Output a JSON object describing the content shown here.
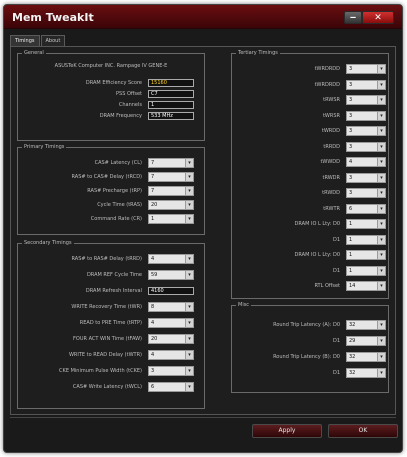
{
  "window": {
    "title": "Mem TweakIt"
  },
  "tabs": [
    {
      "label": "Timings"
    },
    {
      "label": "About"
    }
  ],
  "general": {
    "label": "General",
    "device": "ASUSTeK Computer INC. Rampage IV GENE-E",
    "rows": [
      {
        "label": "DRAM Efficiency Score",
        "value": "15160",
        "highlight": true
      },
      {
        "label": "PSS Offset",
        "value": "C7"
      },
      {
        "label": "Channels",
        "value": "1"
      },
      {
        "label": "DRAM Frequency",
        "value": "533 MHz"
      }
    ]
  },
  "primary": {
    "label": "Primary Timings",
    "rows": [
      {
        "label": "CAS# Latency (CL)",
        "value": "7"
      },
      {
        "label": "RAS# to CAS# Delay (tRCD)",
        "value": "7"
      },
      {
        "label": "RAS# Precharge (tRP)",
        "value": "7"
      },
      {
        "label": "Cycle Time (tRAS)",
        "value": "20"
      },
      {
        "label": "Command Rate (CR)",
        "value": "1"
      }
    ]
  },
  "secondary": {
    "label": "Secondary Timings",
    "rows": [
      {
        "label": "RAS# to RAS# Delay (tRRD)",
        "value": "4",
        "type": "select"
      },
      {
        "label": "DRAM REF Cycle Time",
        "value": "59",
        "type": "select"
      },
      {
        "label": "DRAM Refresh Interval",
        "value": "4160",
        "type": "input"
      },
      {
        "label": "WRITE Recovery Time (tWR)",
        "value": "8",
        "type": "select"
      },
      {
        "label": "READ to PRE Time (tRTP)",
        "value": "4",
        "type": "select"
      },
      {
        "label": "FOUR ACT WIN Time (tFAW)",
        "value": "20",
        "type": "select"
      },
      {
        "label": "WRITE to READ Delay (tWTR)",
        "value": "4",
        "type": "select"
      },
      {
        "label": "CKE Minimum Pulse Width (tCKE)",
        "value": "3",
        "type": "select"
      },
      {
        "label": "CAS# Write Latency (tWCL)",
        "value": "6",
        "type": "select"
      }
    ]
  },
  "tertiary": {
    "label": "Tertiary Timings",
    "rows": [
      {
        "label": "tWRDRDD",
        "value": "3"
      },
      {
        "label": "tWRDRDD",
        "value": "3"
      },
      {
        "label": "tRWSR",
        "value": "3"
      },
      {
        "label": "tWRSR",
        "value": "3"
      },
      {
        "label": "tWRDD",
        "value": "3"
      },
      {
        "label": "tRRDD",
        "value": "3"
      },
      {
        "label": "tWWDD",
        "value": "4"
      },
      {
        "label": "tRWDR",
        "value": "3"
      },
      {
        "label": "tRWDD",
        "value": "3"
      },
      {
        "label": "tRWTR",
        "value": "6"
      },
      {
        "label": "DRAM IO L Lty: D0",
        "value": "1"
      },
      {
        "label": "D1",
        "value": "1"
      },
      {
        "label": "DRAM IO L Lty: D0",
        "value": "1"
      },
      {
        "label": "D1",
        "value": "1"
      },
      {
        "label": "RTL Offset",
        "value": "14"
      }
    ]
  },
  "misc": {
    "label": "Misc",
    "rows": [
      {
        "label": "Round Trip Latency (A): D0",
        "value": "32"
      },
      {
        "label": "D1",
        "value": "29"
      },
      {
        "label": "Round Trip Latency (B): D0",
        "value": "32"
      },
      {
        "label": "D1",
        "value": "32"
      }
    ]
  },
  "buttons": {
    "apply": "Apply",
    "ok": "OK"
  },
  "icons": {
    "dropdown": "chevron-down-icon",
    "close": "close-icon",
    "minimize": "minimize-icon"
  }
}
